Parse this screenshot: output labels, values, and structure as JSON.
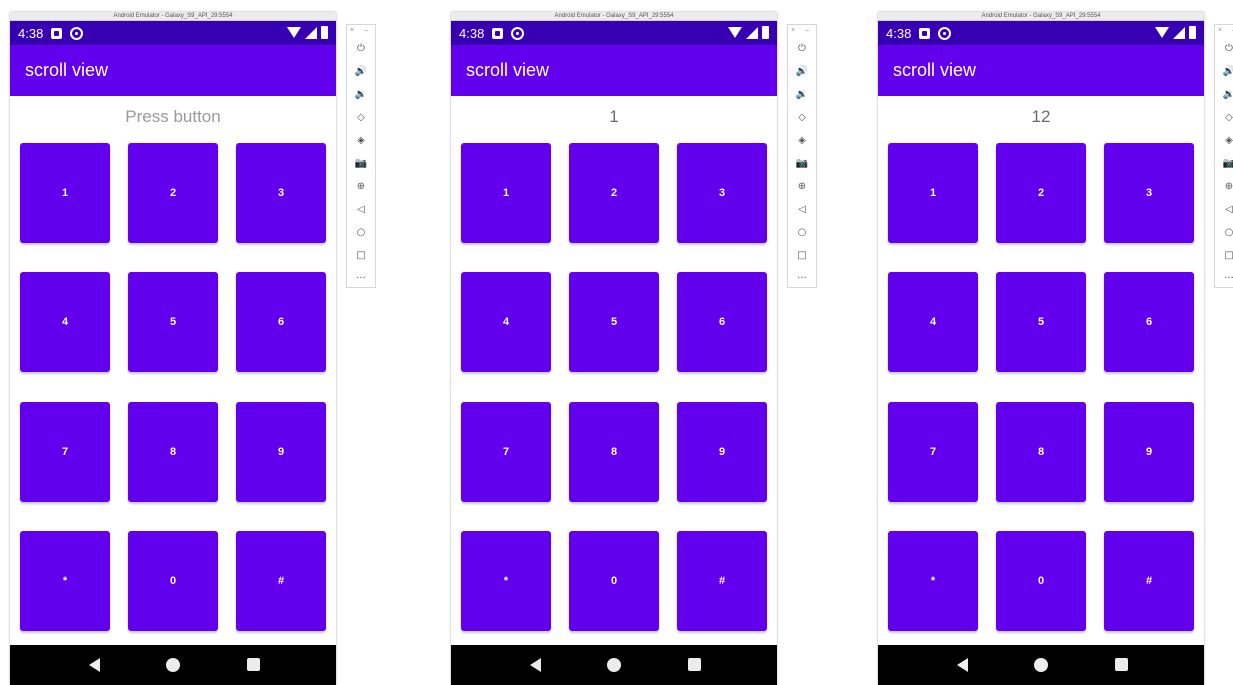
{
  "emulator": {
    "window_title": "Android Emulator - Galaxy_S9_API_29:5554",
    "status_time": "4:38",
    "app_title": "scroll view",
    "toolbar_header": "× –",
    "toolbar_icons": [
      {
        "name": "power-icon",
        "glyph": "⏻"
      },
      {
        "name": "volume-up-icon",
        "glyph": "🔊"
      },
      {
        "name": "volume-down-icon",
        "glyph": "🔉"
      },
      {
        "name": "rotate-left-icon",
        "glyph": "◇"
      },
      {
        "name": "rotate-right-icon",
        "glyph": "◈"
      },
      {
        "name": "screenshot-icon",
        "glyph": "📷"
      },
      {
        "name": "zoom-icon",
        "glyph": "⊕"
      },
      {
        "name": "back-icon",
        "glyph": "◁"
      },
      {
        "name": "home-icon",
        "glyph": "○"
      },
      {
        "name": "overview-icon",
        "glyph": "□"
      },
      {
        "name": "more-icon",
        "glyph": "···"
      }
    ]
  },
  "keys": [
    "1",
    "2",
    "3",
    "4",
    "5",
    "6",
    "7",
    "8",
    "9",
    "*",
    "0",
    "#"
  ],
  "screens": [
    {
      "display": "Press button",
      "hint": true
    },
    {
      "display": "1",
      "hint": false
    },
    {
      "display": "12",
      "hint": false
    }
  ],
  "colors": {
    "primary": "#6200ee",
    "status_bar": "#3700b3",
    "nav_bar": "#000000"
  }
}
